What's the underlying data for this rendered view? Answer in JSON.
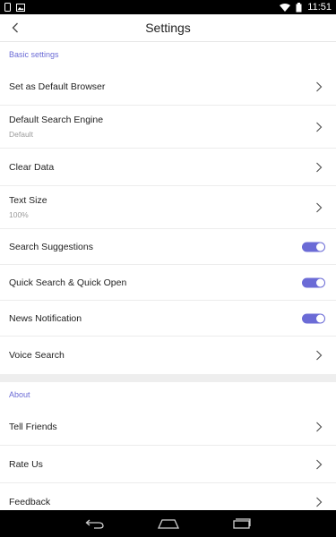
{
  "status_bar": {
    "time": "11:51"
  },
  "app_bar": {
    "title": "Settings"
  },
  "basic": {
    "title": "Basic settings",
    "items": [
      {
        "label": "Set as Default Browser"
      },
      {
        "label": "Default Search Engine",
        "sub": "Default"
      },
      {
        "label": "Clear Data"
      },
      {
        "label": "Text Size",
        "sub": "100%"
      },
      {
        "label": "Search Suggestions",
        "toggle": true
      },
      {
        "label": "Quick Search & Quick Open",
        "toggle": true
      },
      {
        "label": "News Notification",
        "toggle": true
      },
      {
        "label": "Voice Search"
      }
    ]
  },
  "about": {
    "title": "About",
    "items": [
      {
        "label": "Tell Friends"
      },
      {
        "label": "Rate Us"
      },
      {
        "label": "Feedback"
      }
    ]
  },
  "colors": {
    "accent": "#6b6bd6"
  }
}
